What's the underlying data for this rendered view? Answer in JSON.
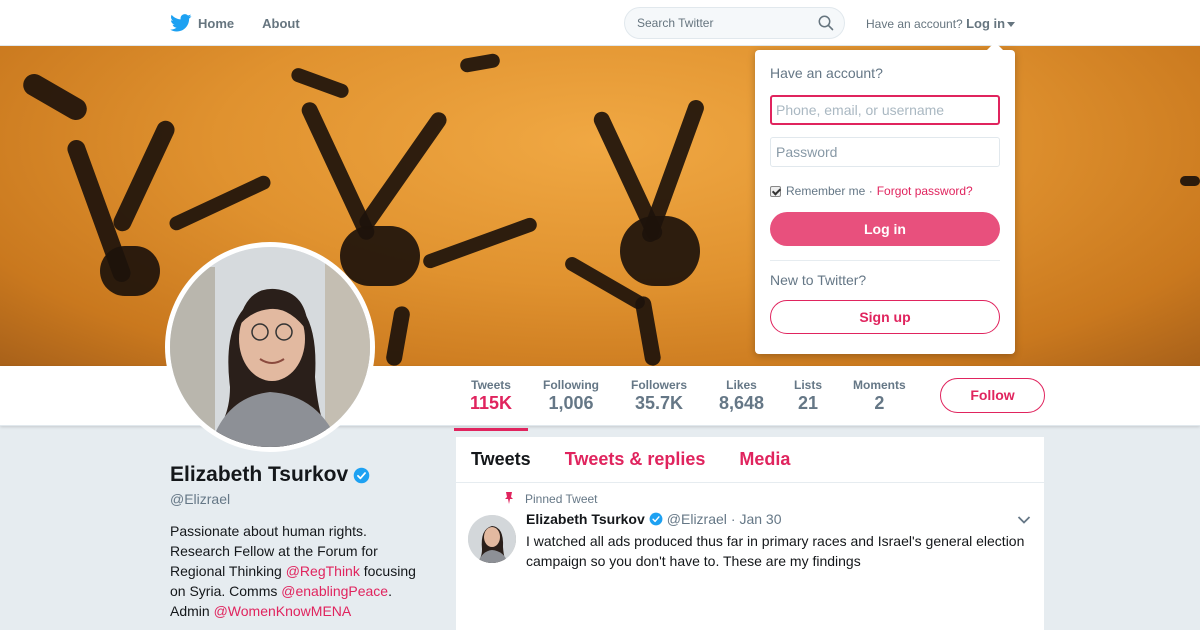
{
  "nav": {
    "home_label": "Home",
    "about_label": "About",
    "search_placeholder": "Search Twitter",
    "have_account": "Have an account?",
    "login_label": "Log in"
  },
  "profile": {
    "name": "Elizabeth Tsurkov",
    "handle": "@Elizrael",
    "bio": {
      "t1": "Passionate about human rights. Research Fellow at the Forum for Regional Thinking ",
      "l1": "@RegThink",
      "t2": " focusing on Syria. Comms ",
      "l2": "@enablingPeace",
      "t3": ". Admin ",
      "l3": "@WomenKnowMENA"
    }
  },
  "stats": [
    {
      "label": "Tweets",
      "value": "115K"
    },
    {
      "label": "Following",
      "value": "1,006"
    },
    {
      "label": "Followers",
      "value": "35.7K"
    },
    {
      "label": "Likes",
      "value": "8,648"
    },
    {
      "label": "Lists",
      "value": "21"
    },
    {
      "label": "Moments",
      "value": "2"
    }
  ],
  "follow_label": "Follow",
  "tabs": [
    "Tweets",
    "Tweets & replies",
    "Media"
  ],
  "tweet": {
    "pinned_label": "Pinned Tweet",
    "name": "Elizabeth Tsurkov",
    "handle": "@Elizrael",
    "date": "· Jan 30",
    "text": "I watched all ads produced thus far in primary races and Israel's general election campaign so you don't have to. These are my findings"
  },
  "login_dropdown": {
    "title": "Have an account?",
    "username_placeholder": "Phone, email, or username",
    "password_placeholder": "Password",
    "remember_label": "Remember me ·",
    "forgot_label": "Forgot password?",
    "login_button": "Log in",
    "new_label": "New to Twitter?",
    "signup_button": "Sign up"
  },
  "colors": {
    "accent": "#e0245e",
    "twitter_blue": "#1da1f2"
  },
  "icons": [
    "twitter-bird-icon",
    "search-icon",
    "caret-down-icon",
    "verified-icon",
    "pin-icon",
    "chevron-down-icon"
  ]
}
